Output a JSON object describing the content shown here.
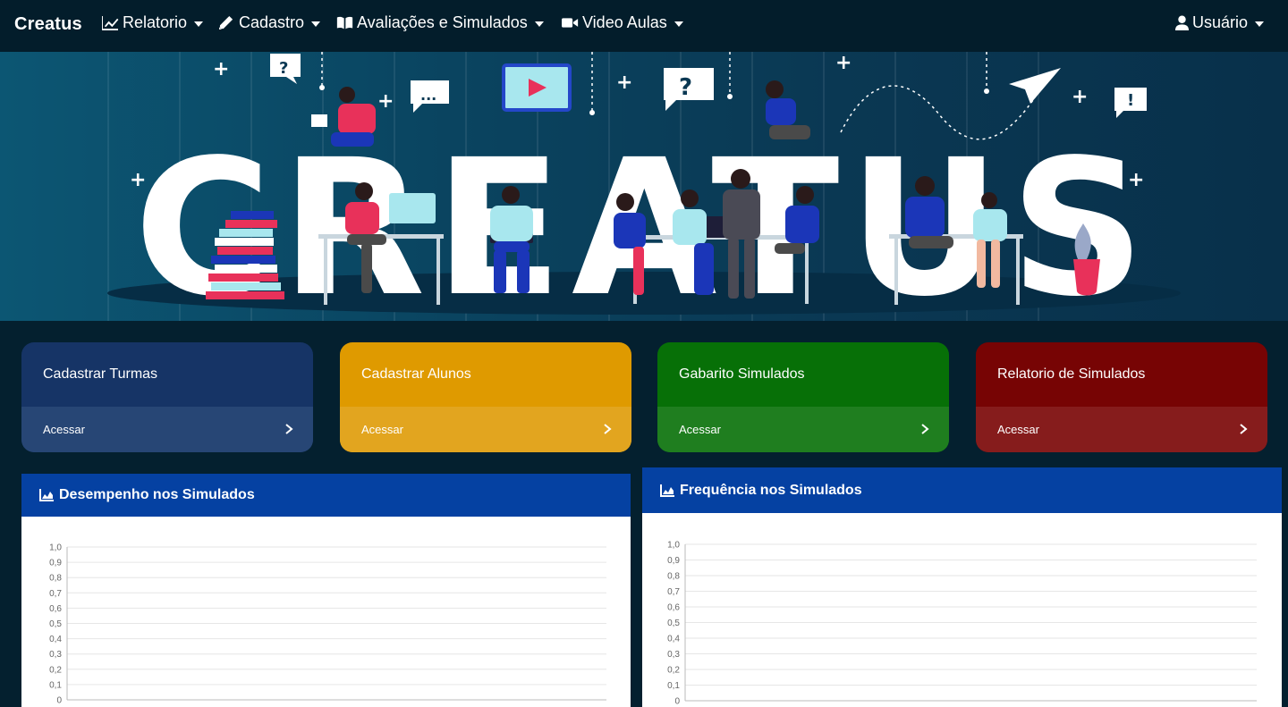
{
  "navbar": {
    "brand": "Creatus",
    "items": [
      {
        "label": "Relatorio",
        "icon": "line-chart-icon"
      },
      {
        "label": "Cadastro",
        "icon": "pencil-icon"
      },
      {
        "label": "Avaliações e Simulados",
        "icon": "book-icon"
      },
      {
        "label": "Video Aulas",
        "icon": "video-camera-icon"
      }
    ],
    "user": {
      "label": "Usuário",
      "icon": "user-icon"
    }
  },
  "hero": {
    "banner_text": "CREATUS"
  },
  "cards": [
    {
      "title": "Cadastrar Turmas",
      "action": "Acessar",
      "color": "#163466",
      "footer_color": "#274675"
    },
    {
      "title": "Cadastrar Alunos",
      "action": "Acessar",
      "color": "#df9a00",
      "footer_color": "#e2a51f"
    },
    {
      "title": "Gabarito Simulados",
      "action": "Acessar",
      "color": "#077007",
      "footer_color": "#1f7e1f"
    },
    {
      "title": "Relatorio de Simulados",
      "action": "Acessar",
      "color": "#770404",
      "footer_color": "#861c1c"
    }
  ],
  "panels": {
    "performance": {
      "title": "Desempenho nos Simulados",
      "icon": "area-chart-icon"
    },
    "frequency": {
      "title": "Frequência nos Simulados",
      "icon": "area-chart-icon"
    }
  },
  "chart_data": [
    {
      "type": "line",
      "ylim": [
        0,
        1
      ],
      "y_ticks": [
        "0",
        "0,1",
        "0,2",
        "0,3",
        "0,4",
        "0,5",
        "0,6",
        "0,7",
        "0,8",
        "0,9",
        "1,0"
      ],
      "series": [],
      "grid": true
    },
    {
      "type": "line",
      "ylim": [
        0,
        1
      ],
      "y_ticks": [
        "0",
        "0,1",
        "0,2",
        "0,3",
        "0,4",
        "0,5",
        "0,6",
        "0,7",
        "0,8",
        "0,9",
        "1,0"
      ],
      "series": [],
      "grid": true
    }
  ],
  "colors": {
    "navbar_bg": "#031d2b",
    "page_bg": "#04202f",
    "panel_header": "#0541a2"
  }
}
